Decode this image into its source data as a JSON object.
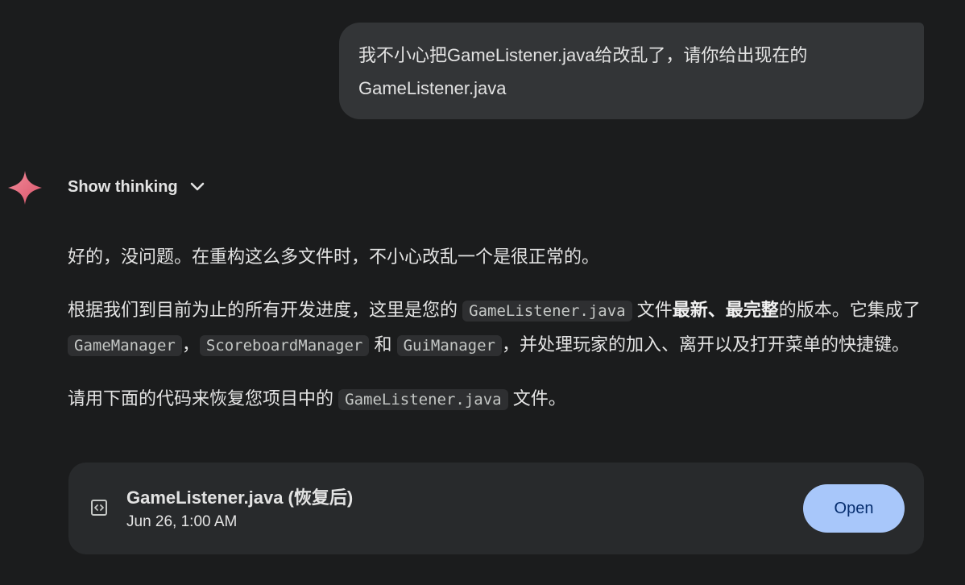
{
  "user_message": {
    "text": "我不小心把GameListener.java给改乱了，请你给出现在的GameListener.java"
  },
  "thinking": {
    "label": "Show thinking",
    "icon": "chevron-down-icon"
  },
  "response": {
    "p1": "好的，没问题。在重构这么多文件时，不小心改乱一个是很正常的。",
    "p2": {
      "t1": "根据我们到目前为止的所有开发进度，这里是您的 ",
      "c1": "GameListener.java",
      "t2": " 文件",
      "b1": "最新、最完整",
      "t3": "的版本。它集成了 ",
      "c2": "GameManager",
      "t4": "，",
      "c3": "ScoreboardManager",
      "t5": " 和 ",
      "c4": "GuiManager",
      "t6": "，并处理玩家的加入、离开以及打开菜单的快捷键。"
    },
    "p3": {
      "t1": "请用下面的代码来恢复您项目中的 ",
      "c1": "GameListener.java",
      "t2": " 文件。"
    }
  },
  "file_card": {
    "icon": "code-icon",
    "title": "GameListener.java (恢复后)",
    "date": "Jun 26, 1:00 AM",
    "open_label": "Open"
  },
  "colors": {
    "background": "#1b1c1d",
    "user_bubble": "#333537",
    "card": "#282a2c",
    "open_button": "#a8c7fa",
    "open_button_text": "#062e6f",
    "gemini_star": "#e66b7d"
  }
}
